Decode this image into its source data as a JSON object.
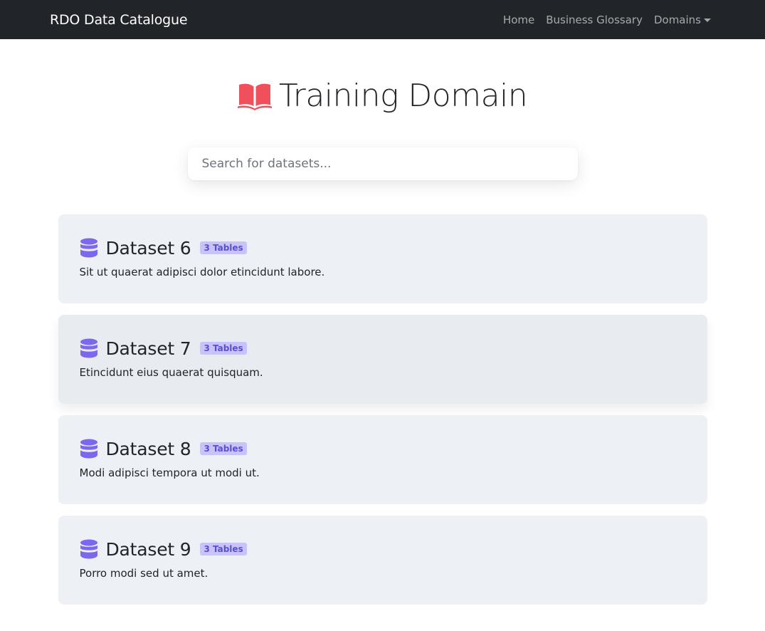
{
  "navbar": {
    "brand": "RDO Data Catalogue",
    "links": [
      {
        "label": "Home"
      },
      {
        "label": "Business Glossary"
      },
      {
        "label": "Domains"
      }
    ]
  },
  "header": {
    "title": "Training Domain",
    "icon": "book-open-icon",
    "icon_color": "#f0505c"
  },
  "search": {
    "placeholder": "Search for datasets..."
  },
  "datasets": [
    {
      "title": "Dataset 6",
      "badge": "3 Tables",
      "description": "Sit ut quaerat adipisci dolor etincidunt labore."
    },
    {
      "title": "Dataset 7",
      "badge": "3 Tables",
      "description": "Etincidunt eius quaerat quisquam."
    },
    {
      "title": "Dataset 8",
      "badge": "3 Tables",
      "description": "Modi adipisci tempora ut modi ut."
    },
    {
      "title": "Dataset 9",
      "badge": "3 Tables",
      "description": "Porro modi sed ut amet."
    }
  ],
  "colors": {
    "navbar_bg": "#212529",
    "card_bg": "#edf0f4",
    "database_icon": "#7b68ee",
    "badge_bg": "#c8c3fb",
    "badge_text": "#5a4fd1"
  }
}
